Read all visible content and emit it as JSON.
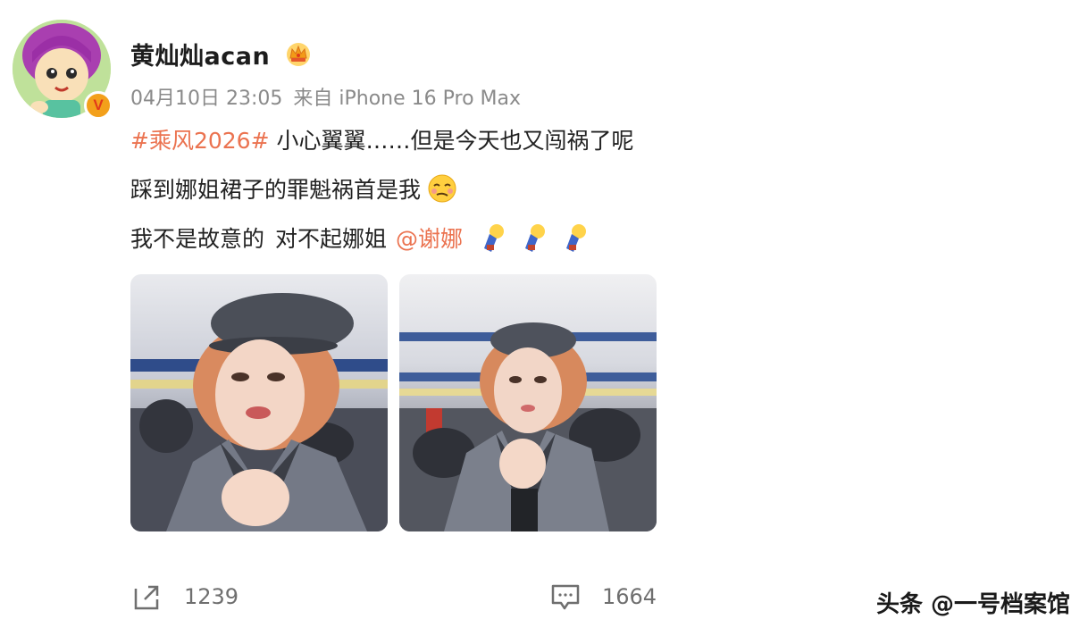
{
  "post": {
    "username": "黄灿灿acan",
    "timestamp": "04月10日 23:05",
    "source": "来自 iPhone 16 Pro Max",
    "line1_hashtag": "#乘风2026#",
    "line1_text": "小心翼翼……但是今天也又闯祸了呢",
    "line2_text": "踩到娜姐裙子的罪魁祸首是我",
    "line3_text": "我不是故意的",
    "line3_text2": "对不起娜姐",
    "line3_mention": "@谢娜",
    "icons": {
      "crown": "crown-icon",
      "verified": "verified-badge-icon",
      "face_emoji": "woozy-face-emoji-icon",
      "bulb_emoji": "lightbulb-emoji-icon",
      "share": "share-icon",
      "comment": "comment-icon"
    }
  },
  "actions": {
    "share_count": "1239",
    "comment_count": "1664"
  },
  "watermark": "头条 @一号档案馆",
  "colors": {
    "link": "#eb7350",
    "meta": "#8a8a8a",
    "verified": "#f3a01b"
  }
}
